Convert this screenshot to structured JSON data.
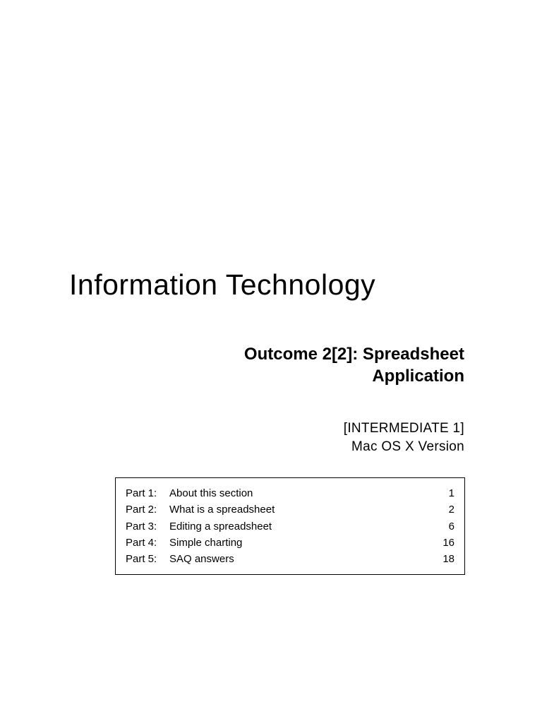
{
  "title": "Information Technology",
  "subtitle": {
    "line1": "Outcome 2[2]: Spreadsheet",
    "line2": "Application"
  },
  "info": {
    "line1": "[INTERMEDIATE 1]",
    "line2": "Mac OS X Version"
  },
  "toc": [
    {
      "part": "Part 1:",
      "title": "About this section",
      "page": "1"
    },
    {
      "part": "Part 2:",
      "title": "What is a spreadsheet",
      "page": "2"
    },
    {
      "part": "Part 3:",
      "title": "Editing a spreadsheet",
      "page": "6"
    },
    {
      "part": "Part 4:",
      "title": "Simple charting",
      "page": "16"
    },
    {
      "part": "Part 5:",
      "title": "SAQ answers",
      "page": "18"
    }
  ]
}
